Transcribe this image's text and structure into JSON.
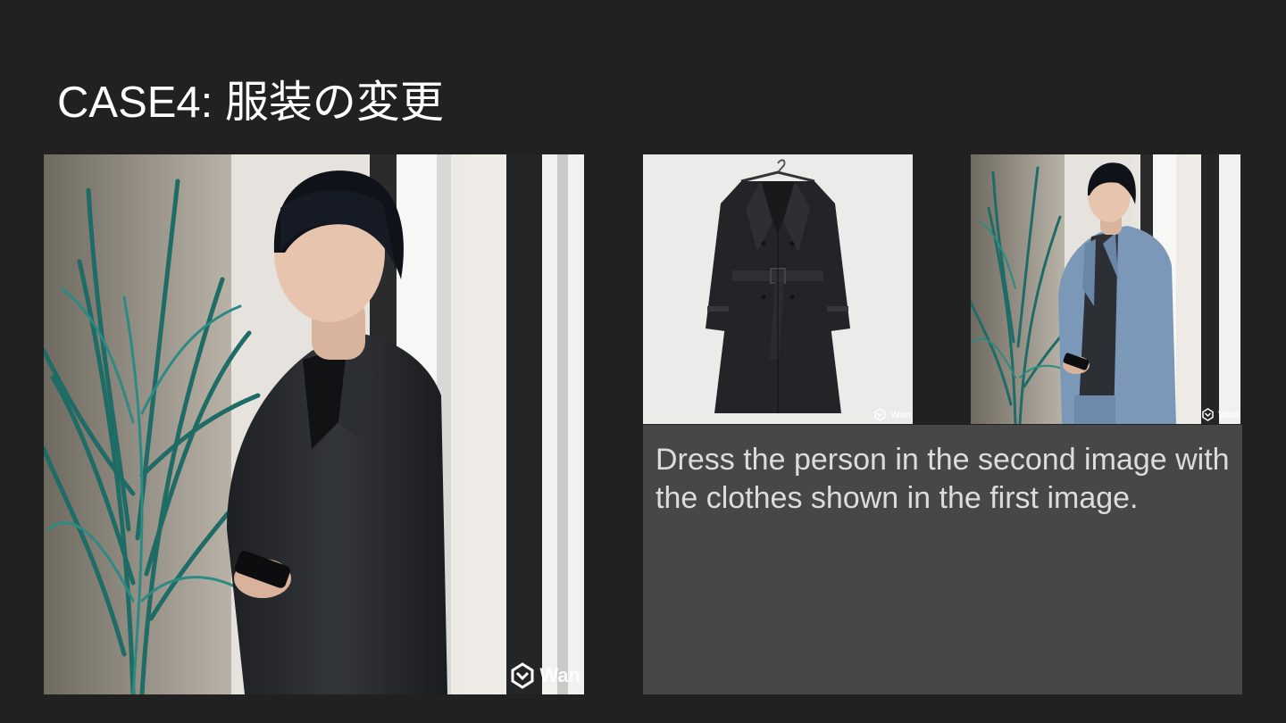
{
  "slide": {
    "title": "CASE4: 服装の変更"
  },
  "images": {
    "reference_person": {
      "icon": "photo-person-black-trench-coat",
      "watermark": "Wan"
    },
    "reference_clothes": {
      "icon": "photo-black-trench-coat-on-hanger",
      "watermark": "Wan"
    },
    "result": {
      "icon": "photo-person-blue-blazer",
      "watermark": "Wan"
    }
  },
  "prompt": {
    "text": "Dress the person in the second image with the clothes shown in the first image."
  },
  "colors": {
    "background": "#212121",
    "prompt_box": "#474747",
    "title_text": "#ffffff",
    "prompt_text": "#dcdcdc"
  }
}
